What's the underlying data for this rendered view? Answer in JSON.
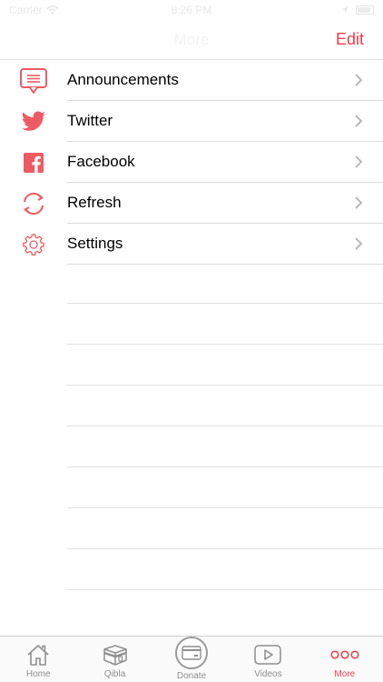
{
  "status_bar": {
    "carrier": "Carrier",
    "time": "8:26 PM"
  },
  "nav": {
    "title": "More",
    "edit_label": "Edit"
  },
  "list": [
    {
      "label": "Announcements",
      "icon": "announcements-icon"
    },
    {
      "label": "Twitter",
      "icon": "twitter-icon"
    },
    {
      "label": "Facebook",
      "icon": "facebook-icon"
    },
    {
      "label": "Refresh",
      "icon": "refresh-icon"
    },
    {
      "label": "Settings",
      "icon": "settings-gear-icon"
    }
  ],
  "tabs": [
    {
      "label": "Home",
      "icon": "home-icon",
      "active": false
    },
    {
      "label": "Qibla",
      "icon": "kaaba-icon",
      "active": false
    },
    {
      "label": "Donate",
      "icon": "card-icon",
      "active": false
    },
    {
      "label": "Videos",
      "icon": "video-play-icon",
      "active": false
    },
    {
      "label": "More",
      "icon": "more-dots-icon",
      "active": true
    }
  ],
  "colors": {
    "accent": "#ee3d4a",
    "tab_inactive": "#8e8e8e",
    "separator": "#dcdcdc"
  }
}
